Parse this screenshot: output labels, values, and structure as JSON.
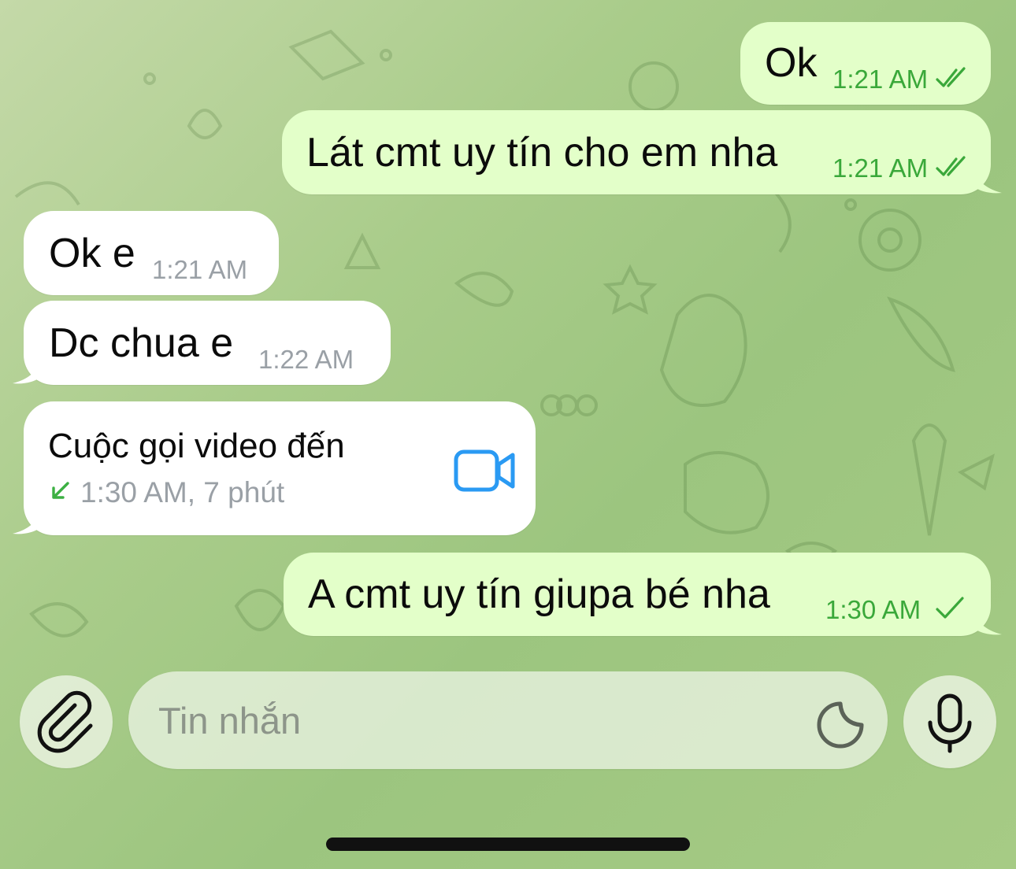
{
  "messages": [
    {
      "text": "Ok",
      "time": "1:21 AM",
      "status": "read"
    },
    {
      "text": "Lát cmt uy tín cho em nha",
      "time": "1:21 AM",
      "status": "read"
    },
    {
      "text": "Ok e",
      "time": "1:21 AM"
    },
    {
      "text": "Dc chua e",
      "time": "1:22 AM"
    },
    {
      "text": "A cmt uy tín giupa bé nha",
      "time": "1:30 AM",
      "status": "sent"
    }
  ],
  "call": {
    "title": "Cuộc gọi video đến",
    "detail": "1:30 AM, 7 phút",
    "direction_icon": "incoming-arrow-icon",
    "call_icon": "video-camera-icon"
  },
  "composer": {
    "placeholder": "Tin nhắn",
    "attach_icon": "paperclip-icon",
    "sticker_icon": "sticker-icon",
    "mic_icon": "microphone-icon"
  },
  "colors": {
    "outgoing_bubble": "#e3ffc9",
    "incoming_bubble": "#ffffff",
    "outgoing_time": "#3aa83a",
    "incoming_time": "#9aa0a6",
    "accent_blue": "#2a9af3",
    "call_arrow_green": "#3cb043"
  }
}
